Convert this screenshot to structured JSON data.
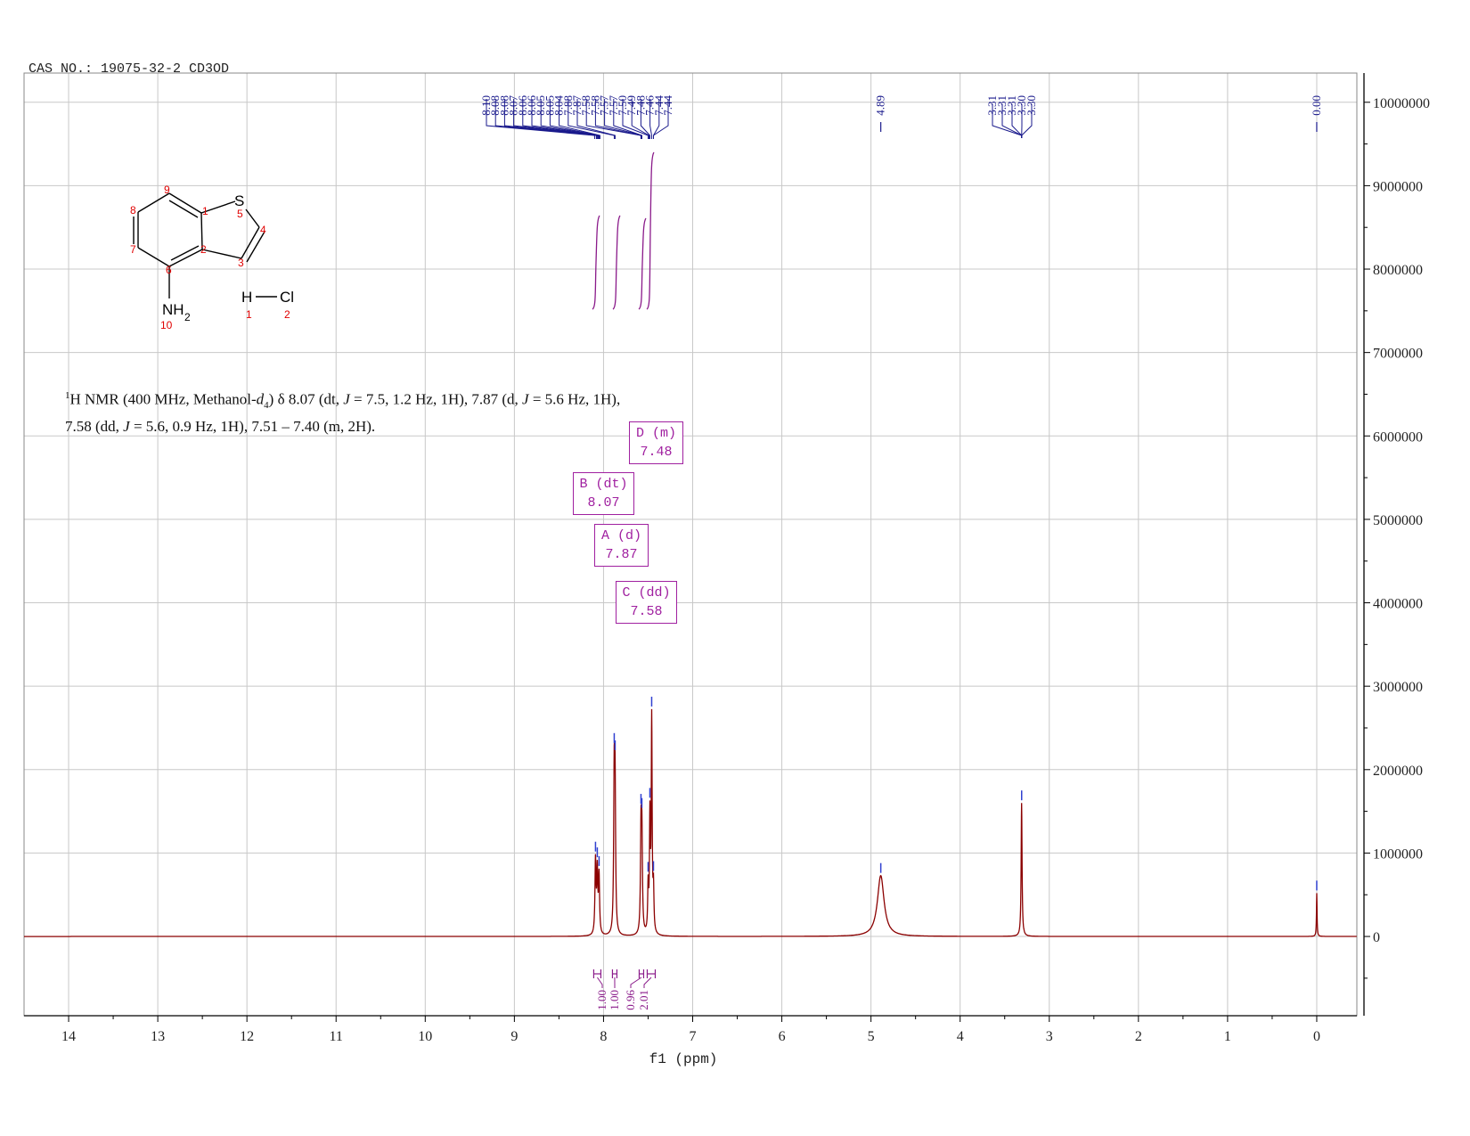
{
  "header": {
    "cas_line": "CAS NO.: 19075-32-2 CD3OD"
  },
  "description": {
    "nucleus_sup": "1",
    "prefix": "H NMR (400 MHz, Methanol-",
    "solvent_italic": "d",
    "solvent_sub": "4",
    "line1_rest": ") δ 8.07 (dt, ",
    "j_symbol": "J",
    "seg1": " = 7.5, 1.2 Hz, 1H), 7.87 (d, ",
    "seg2": " = 5.6 Hz, 1H),",
    "seg3": "7.58 (dd, ",
    "seg4": " = 5.6, 0.9 Hz, 1H), 7.51 – 7.40 (m, 2H)."
  },
  "structure": {
    "atom_S": "S",
    "atom_NH": "NH",
    "atom_NH_sub": "2",
    "atom_H": "H",
    "atom_Cl": "Cl",
    "numbers": [
      "9",
      "8",
      "1",
      "S5",
      "4",
      "7",
      "2",
      "3",
      "6",
      "10"
    ],
    "num": {
      "n1": "1",
      "n2": "2",
      "n3": "3",
      "n4": "4",
      "n5": "5",
      "n6": "6",
      "n7": "7",
      "n8": "8",
      "n9": "9",
      "n10": "10",
      "h1": "1",
      "cl2": "2"
    }
  },
  "multiplets": [
    {
      "label": "D (m)",
      "shift": "7.48"
    },
    {
      "label": "B (dt)",
      "shift": "8.07"
    },
    {
      "label": "A (d)",
      "shift": "7.87"
    },
    {
      "label": "C (dd)",
      "shift": "7.58"
    }
  ],
  "chart_data": {
    "type": "line",
    "title": "",
    "xlabel": "f1 (ppm)",
    "ylabel": "",
    "xlim": [
      14.5,
      -0.45
    ],
    "ylim": [
      -950000,
      10350000
    ],
    "x_reversed": true,
    "grid": true,
    "x_ticks": [
      14,
      13,
      12,
      11,
      10,
      9,
      8,
      7,
      6,
      5,
      4,
      3,
      2,
      1,
      0
    ],
    "x_tick_labels": [
      "14",
      "13",
      "12",
      "11",
      "10",
      "9",
      "8",
      "7",
      "6",
      "5",
      "4",
      "3",
      "2",
      "1",
      "0"
    ],
    "y_ticks": [
      0,
      1000000,
      2000000,
      3000000,
      4000000,
      5000000,
      6000000,
      7000000,
      8000000,
      9000000,
      10000000
    ],
    "y_tick_labels": [
      "0",
      "1000000",
      "2000000",
      "3000000",
      "4000000",
      "5000000",
      "6000000",
      "7000000",
      "8000000",
      "9000000",
      "10000000"
    ],
    "peaks": [
      {
        "ppm": 8.09,
        "height": 880000,
        "width": 0.007
      },
      {
        "ppm": 8.07,
        "height": 740000,
        "width": 0.007
      },
      {
        "ppm": 8.05,
        "height": 700000,
        "width": 0.007
      },
      {
        "ppm": 7.88,
        "height": 1750000,
        "width": 0.007
      },
      {
        "ppm": 7.87,
        "height": 1620000,
        "width": 0.007
      },
      {
        "ppm": 7.58,
        "height": 1180000,
        "width": 0.007
      },
      {
        "ppm": 7.57,
        "height": 1100000,
        "width": 0.007
      },
      {
        "ppm": 7.5,
        "height": 550000,
        "width": 0.006
      },
      {
        "ppm": 7.48,
        "height": 1350000,
        "width": 0.006
      },
      {
        "ppm": 7.46,
        "height": 2550000,
        "width": 0.006
      },
      {
        "ppm": 7.44,
        "height": 500000,
        "width": 0.006
      },
      {
        "ppm": 4.89,
        "height": 730000,
        "width": 0.045
      },
      {
        "ppm": 3.31,
        "height": 1600000,
        "width": 0.006
      },
      {
        "ppm": 0.0,
        "height": 520000,
        "width": 0.004
      }
    ],
    "peak_labels": [
      {
        "group": "aromatic",
        "values": [
          "8.10",
          "8.08",
          "8.08",
          "8.07",
          "8.06",
          "8.06",
          "8.05",
          "8.05",
          "8.04",
          "7.88",
          "7.87",
          "7.58",
          "7.58",
          "7.57",
          "7.57",
          "7.50",
          "7.49",
          "7.48",
          "7.46",
          "7.44",
          "7.44"
        ]
      },
      {
        "group": "water",
        "values": [
          "4.89"
        ]
      },
      {
        "group": "solvent",
        "values": [
          "3.31",
          "3.31",
          "3.31",
          "3.30",
          "3.30"
        ]
      },
      {
        "group": "tms",
        "values": [
          "0.00"
        ]
      }
    ],
    "integrals": [
      {
        "from": 8.11,
        "to": 8.03,
        "value": "1.00"
      },
      {
        "from": 7.9,
        "to": 7.85,
        "value": "1.00"
      },
      {
        "from": 7.6,
        "to": 7.55,
        "value": "0.96"
      },
      {
        "from": 7.51,
        "to": 7.42,
        "value": "2.01"
      }
    ],
    "colors": {
      "spectrum": "#8b0000",
      "peak_label": "#1a1a8c",
      "integral": "#8a1a8a",
      "grid": "#c8c8c8"
    }
  }
}
